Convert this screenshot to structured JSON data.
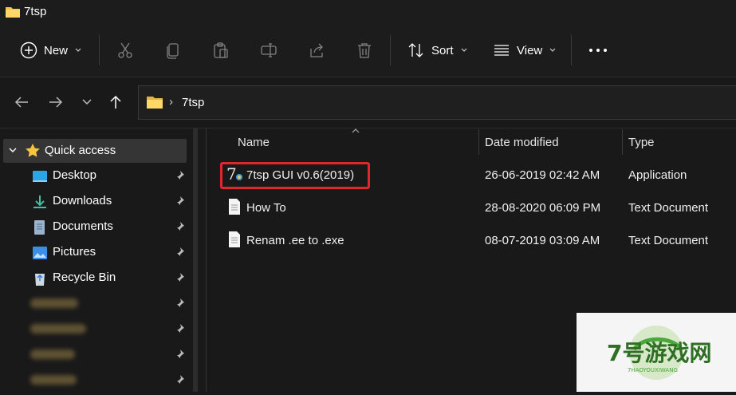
{
  "window": {
    "title": "7tsp"
  },
  "toolbar": {
    "new_label": "New",
    "sort_label": "Sort",
    "view_label": "View",
    "icons": [
      "cut-icon",
      "copy-icon",
      "paste-icon",
      "rename-icon",
      "share-icon",
      "delete-icon"
    ]
  },
  "address": {
    "path_item": "7tsp",
    "separator": "›"
  },
  "sidebar": {
    "header": "Quick access",
    "items": [
      {
        "label": "Desktop",
        "icon": "desktop-icon"
      },
      {
        "label": "Downloads",
        "icon": "downloads-icon"
      },
      {
        "label": "Documents",
        "icon": "documents-icon"
      },
      {
        "label": "Pictures",
        "icon": "pictures-icon"
      },
      {
        "label": "Recycle Bin",
        "icon": "recycle-bin-icon"
      }
    ]
  },
  "columns": {
    "name": "Name",
    "date": "Date modified",
    "type": "Type"
  },
  "files": [
    {
      "name": "7tsp GUI v0.6(2019)",
      "date": "26-06-2019 02:42 AM",
      "type": "Application"
    },
    {
      "name": "How To",
      "date": "28-08-2020 06:09 PM",
      "type": "Text Document"
    },
    {
      "name": "Renam .ee to .exe",
      "date": "08-07-2019 03:09 AM",
      "type": "Text Document"
    }
  ],
  "watermark": {
    "brand": "7号游戏网",
    "sub": "7HAOYOUXIWANG"
  },
  "colors": {
    "accent_red": "#e0252c",
    "folder": "#f2c14e",
    "background": "#191919"
  }
}
